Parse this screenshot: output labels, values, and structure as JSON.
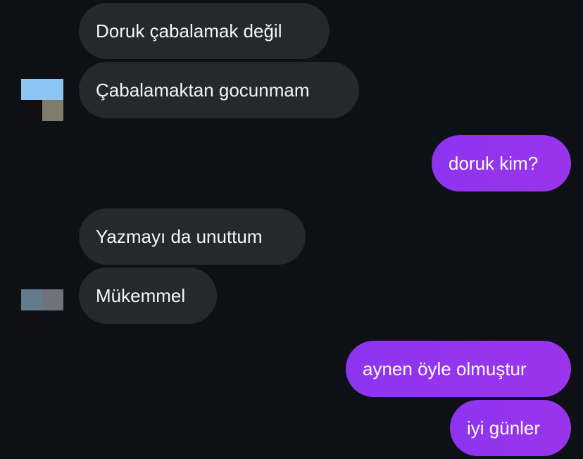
{
  "messages": [
    {
      "direction": "incoming",
      "text": "Doruk çabalamak değil"
    },
    {
      "direction": "incoming",
      "text": "Çabalamaktan gocunmam"
    },
    {
      "direction": "outgoing",
      "text": "doruk kim?"
    },
    {
      "direction": "incoming",
      "text": "Yazmayı da unuttum"
    },
    {
      "direction": "incoming",
      "text": "Mükemmel"
    },
    {
      "direction": "outgoing",
      "text": "aynen öyle olmuştur"
    },
    {
      "direction": "outgoing",
      "text": "iyi günler"
    }
  ],
  "colors": {
    "background": "#0d1015",
    "incoming_bubble": "#25282d",
    "outgoing_bubble": "#9034ef",
    "text": "#f4f5f7"
  },
  "avatars": [
    {
      "icon": "contact-avatar-pixelated",
      "pixels": [
        "#8cc4f2",
        "#8cc4f2",
        "#120d10",
        "#7d7d6c"
      ]
    },
    {
      "icon": "contact-avatar-pixelated",
      "pixels": [
        "#647a8d",
        "#70737b",
        "#120d10",
        "#0d1015"
      ]
    }
  ]
}
